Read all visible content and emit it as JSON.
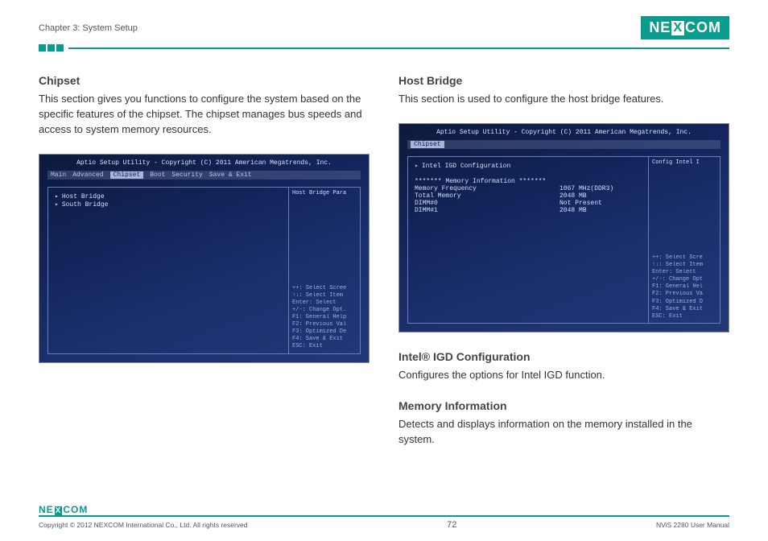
{
  "header": {
    "chapter": "Chapter 3: System Setup",
    "logo": "NEXCOM"
  },
  "left": {
    "heading": "Chipset",
    "text": "This section gives you functions to configure the system based on the specific features of the chipset. The chipset manages bus speeds and access to system memory resources.",
    "bios": {
      "title": "Aptio Setup Utility - Copyright (C) 2011 American Megatrends, Inc.",
      "menu": [
        "Main",
        "Advanced",
        "Chipset",
        "Boot",
        "Security",
        "Save & Exit"
      ],
      "selected_tab": "Chipset",
      "items": [
        "Host Bridge",
        "South Bridge"
      ],
      "side_top": "Host Bridge Para",
      "help": [
        "++: Select Scree",
        "↑↓: Select Item",
        "Enter: Select",
        "+/-: Change Opt.",
        "F1: General Help",
        "F2: Previous Val",
        "F3: Optimized De",
        "F4: Save & Exit",
        "ESC: Exit"
      ]
    }
  },
  "right": {
    "heading1": "Host Bridge",
    "text1": "This section is used to configure the host bridge features.",
    "bios": {
      "title": "Aptio Setup Utility - Copyright (C) 2011 American Megatrends, Inc.",
      "menu_selected": "Chipset",
      "config_link": "Intel IGD Configuration",
      "side_top": "Config Intel I",
      "mem_header": "******* Memory Information *******",
      "rows": [
        {
          "label": "Memory Frequency",
          "value": "1067 MHz(DDR3)"
        },
        {
          "label": "Total Memory",
          "value": "2048 MB"
        },
        {
          "label": "DIMM#0",
          "value": "Not Present"
        },
        {
          "label": "DIMM#1",
          "value": "2048 MB"
        }
      ],
      "help": [
        "++: Select Scre",
        "↑↓: Select Item",
        "Enter: Select",
        "+/-: Change Opt",
        "F1: General Hel",
        "F2: Previous Va",
        "F3: Optimized D",
        "F4: Save & Exit",
        "ESC: Exit"
      ]
    },
    "heading2": "Intel® IGD Configuration",
    "text2": "Configures the options for Intel IGD function.",
    "heading3": "Memory Information",
    "text3": "Detects and displays information on the memory installed in the system."
  },
  "footer": {
    "copyright": "Copyright © 2012 NEXCOM International Co., Ltd. All rights reserved",
    "page": "72",
    "manual": "NViS 2280 User Manual",
    "logo": "NEXCOM"
  }
}
